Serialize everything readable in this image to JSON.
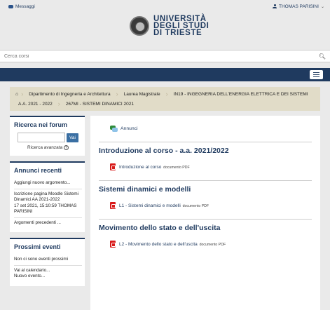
{
  "topbar": {
    "messages": "Messaggi",
    "user": "THOMAS PARISINI",
    "caret": "⌄"
  },
  "logo": {
    "line1": "UNIVERSITÀ",
    "line2": "DEGLI STUDI",
    "line3": "DI TRIESTE"
  },
  "search": {
    "placeholder": "Cerca corsi",
    "icon": "search-icon"
  },
  "breadcrumb": [
    "Dipartimento di Ingegneria e Architettura",
    "Laurea Magistrale",
    "IN19 - INGEGNERIA DELL'ENERGIA ELETTRICA E DEI SISTEMI",
    "A.A. 2021 - 2022",
    "267MI - SISTEMI DINAMICI 2021"
  ],
  "sidebar": {
    "forum": {
      "title": "Ricerca nei forum",
      "button": "Vai",
      "advanced": "Ricerca avanzata",
      "help": "?"
    },
    "news": {
      "title": "Annunci recenti",
      "items": [
        "Aggiungi nuovo argomento...",
        "Iscrizione pagina Moodle Sistemi Dinamici AA 2021-2022",
        "17 set 2021, 15:10:59 THOMAS PARISINI",
        "Argomenti precedenti ..."
      ]
    },
    "events": {
      "title": "Prossimi eventi",
      "items": [
        "Non ci sono eventi prossimi",
        "Vai al calendario...",
        "Nuovo evento..."
      ]
    }
  },
  "main": {
    "annunci": "Annunci",
    "sections": [
      {
        "title": "Introduzione al corso - a.a. 2021/2022",
        "resource": "Introduzione al corso",
        "kind": "documento PDF"
      },
      {
        "title": "Sistemi dinamici e modelli",
        "resource": "L1 - Sistemi dinamici e modelli",
        "kind": "documento PDF"
      },
      {
        "title": "Movimento dello stato e dell'uscita",
        "resource": "L2 - Movimento dello stato e dell'uscita",
        "kind": "documento PDF"
      }
    ]
  },
  "colors": {
    "brand": "#1f3a5f",
    "breadcrumb_bg": "#e1dcc8",
    "pdf": "#d81a1a"
  }
}
